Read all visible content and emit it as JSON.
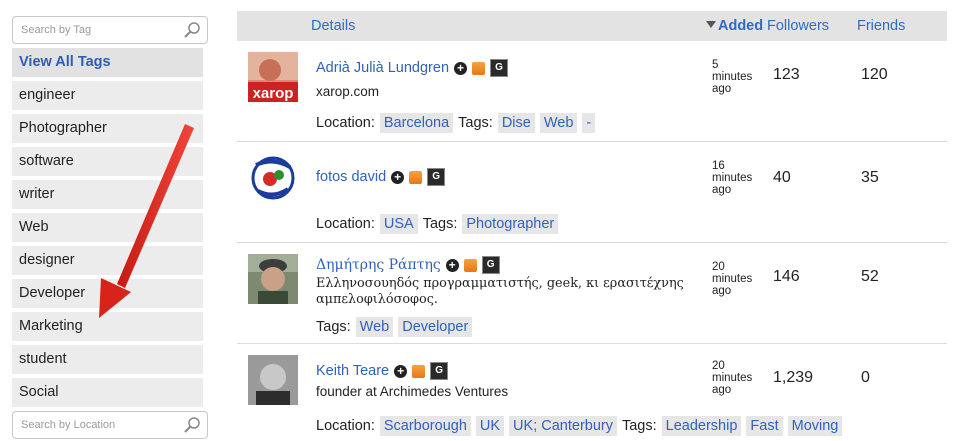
{
  "sidebar": {
    "tag_search_placeholder": "Search by Tag",
    "location_search_placeholder": "Search by Location",
    "tags": [
      "View All Tags",
      "engineer",
      "Photographer",
      "software",
      "writer",
      "Web",
      "designer",
      "Developer",
      "Marketing",
      "student",
      "Social"
    ]
  },
  "header": {
    "details": "Details",
    "added": "Added",
    "followers": "Followers",
    "friends": "Friends"
  },
  "users": [
    {
      "name": "Adrià Julià Lundgren",
      "bio": "xarop.com",
      "time": [
        "5",
        "minutes",
        "ago"
      ],
      "followers": "123",
      "friends": "120",
      "location_label": "Location:",
      "locations": [
        "Barcelona"
      ],
      "tags_label": "Tags:",
      "tags": [
        "Dise",
        "Web",
        "-"
      ],
      "avatar_text": "xarop"
    },
    {
      "name": "fotos david",
      "bio": "",
      "time": [
        "16",
        "minutes",
        "ago"
      ],
      "followers": "40",
      "friends": "35",
      "location_label": "Location:",
      "locations": [
        "USA"
      ],
      "tags_label": "Tags:",
      "tags": [
        "Photographer"
      ]
    },
    {
      "name": "Δημήτρης Ράπτης",
      "bio_lines": [
        "Ελληνοσουηδός προγραμματιστής, geek, κι ερασιτέχνης",
        "αμπελοφιλόσοφος."
      ],
      "time": [
        "20",
        "minutes",
        "ago"
      ],
      "followers": "146",
      "friends": "52",
      "tags_label": "Tags:",
      "tags": [
        "Web",
        "Developer"
      ]
    },
    {
      "name": "Keith Teare",
      "bio": "founder at Archimedes Ventures",
      "time": [
        "20",
        "minutes",
        "ago"
      ],
      "followers": "1,239",
      "friends": "0",
      "location_label": "Location:",
      "locations": [
        "Scarborough",
        "UK",
        "UK; Canterbury"
      ],
      "tags_label": "Tags:",
      "tags": [
        "Leadership",
        "Fast",
        "Moving"
      ]
    }
  ],
  "colors": {
    "link": "#2f62b8",
    "chip_bg": "#e6e6e6",
    "arrow": "#e0261b"
  },
  "icons": [
    "search-icon",
    "add-icon",
    "rss-icon",
    "google-icon",
    "arrow-annotation"
  ]
}
